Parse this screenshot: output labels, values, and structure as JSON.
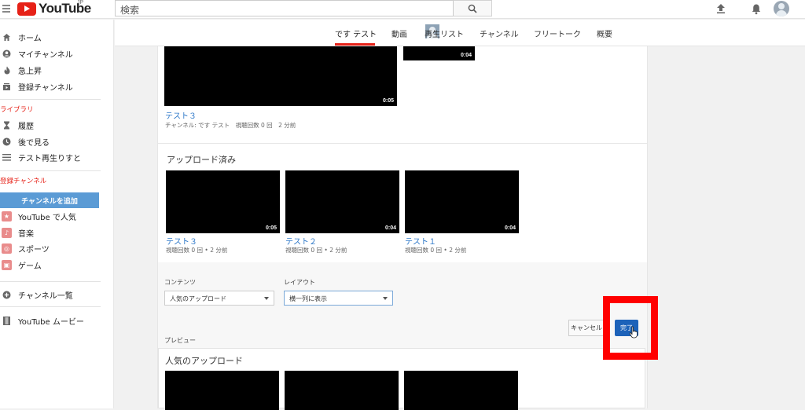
{
  "header": {
    "logo_text": "YouTube",
    "region": "JP",
    "search_placeholder": "検索",
    "icons": [
      "menu-icon",
      "search-icon",
      "upload-icon",
      "bell-icon",
      "account-avatar"
    ]
  },
  "sidebar": {
    "main_items": [
      {
        "label": "ホーム",
        "icon": "home-icon"
      },
      {
        "label": "マイチャンネル",
        "icon": "account-icon"
      },
      {
        "label": "急上昇",
        "icon": "flame-icon"
      },
      {
        "label": "登録チャンネル",
        "icon": "subscriptions-icon"
      }
    ],
    "library_heading": "ライブラリ",
    "library_items": [
      {
        "label": "履歴",
        "icon": "hourglass-icon"
      },
      {
        "label": "後で見る",
        "icon": "clock-icon"
      },
      {
        "label": "テスト再生りすと",
        "icon": "playlist-icon"
      }
    ],
    "subs_heading": "登録チャンネル",
    "add_channel_label": "チャンネルを追加",
    "sub_items": [
      {
        "label": "YouTube で人気",
        "icon": "star-icon"
      },
      {
        "label": "音楽",
        "icon": "music-icon"
      },
      {
        "label": "スポーツ",
        "icon": "sports-icon"
      },
      {
        "label": "ゲーム",
        "icon": "gamepad-icon"
      }
    ],
    "channel_list_label": "チャンネル一覧",
    "movies_label": "YouTube ムービー"
  },
  "channel_tabs": {
    "channel_name": "です テスト",
    "tabs": [
      "動画",
      "再生リスト",
      "チャンネル",
      "フリートーク",
      "概要"
    ]
  },
  "featured": {
    "video_title": "テスト３",
    "video_duration": "0:05",
    "video_meta": "チャンネル: です テスト　視聴回数 0 回　2 分前",
    "side_duration": "0:04"
  },
  "uploads": {
    "title": "アップロード済み",
    "videos": [
      {
        "title": "テスト３",
        "duration": "0:05",
        "meta": "視聴回数 0 回 • 2 分前"
      },
      {
        "title": "テスト２",
        "duration": "0:04",
        "meta": "視聴回数 0 回 • 2 分前"
      },
      {
        "title": "テスト１",
        "duration": "0:04",
        "meta": "視聴回数 0 回 • 2 分前"
      }
    ]
  },
  "editor": {
    "content_label": "コンテンツ",
    "content_value": "人気のアップロード",
    "layout_label": "レイアウト",
    "layout_value": "横一列に表示",
    "cancel_label": "キャンセル",
    "done_label": "完了",
    "preview_label": "プレビュー",
    "preview_title": "人気のアップロード"
  },
  "colors": {
    "brand_red": "#e62117",
    "link_blue": "#2f79c9",
    "primary_button": "#1c62b9",
    "highlight": "#ff0000"
  }
}
